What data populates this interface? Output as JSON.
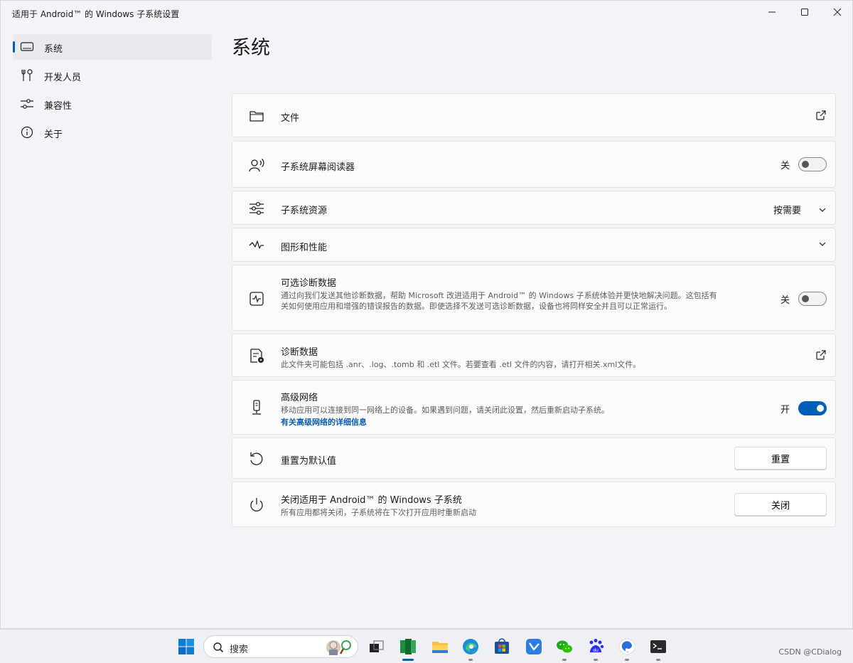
{
  "window": {
    "title": "适用于 Android™ 的 Windows 子系统设置"
  },
  "sidebar": {
    "items": [
      {
        "label": "系统",
        "icon": "monitor-icon",
        "active": true
      },
      {
        "label": "开发人员",
        "icon": "tools-icon"
      },
      {
        "label": "兼容性",
        "icon": "sliders-icon"
      },
      {
        "label": "关于",
        "icon": "info-icon"
      }
    ]
  },
  "page": {
    "title": "系统"
  },
  "settings": {
    "files": {
      "label": "文件",
      "icon": "folder-icon",
      "action_icon": "external-link-icon"
    },
    "screen_reader": {
      "label": "子系统屏幕阅读器",
      "icon": "screen-reader-icon",
      "state": "关",
      "toggle": "off"
    },
    "resources": {
      "label": "子系统资源",
      "icon": "sliders-icon",
      "value": "按需要",
      "action_icon": "chevron-down-icon"
    },
    "graphics": {
      "label": "图形和性能",
      "icon": "performance-icon",
      "action_icon": "chevron-down-icon"
    },
    "optional_diag": {
      "label": "可选诊断数据",
      "icon": "activity-icon",
      "desc": "通过向我们发送其他诊断数据，帮助 Microsoft 改进适用于 Android™ 的 Windows 子系统体验并更快地解决问题。这包括有关如何使用应用和增强的错误报告的数据。即使选择不发送可选诊断数据，设备也将同样安全并且可以正常运行。",
      "state": "关",
      "toggle": "off"
    },
    "diag_data": {
      "label": "诊断数据",
      "icon": "diagnostic-file-icon",
      "desc": "此文件夹可能包括 .anr、.log、.tomb 和 .etl 文件。若要查看 .etl 文件的内容，请打开相关.xml文件。",
      "action_icon": "external-link-icon"
    },
    "advanced_net": {
      "label": "高级网络",
      "icon": "network-device-icon",
      "desc": "移动应用可以连接到同一网络上的设备。如果遇到问题，请关闭此设置，然后重新启动子系统。",
      "link": "有关高级网络的详细信息",
      "state": "开",
      "toggle": "on"
    },
    "reset": {
      "label": "重置为默认值",
      "icon": "reset-icon",
      "button": "重置"
    },
    "shutdown": {
      "label": "关闭适用于 Android™ 的 Windows 子系统",
      "icon": "power-icon",
      "desc": "所有应用都将关闭，子系统将在下次打开应用时重新启动",
      "button": "关闭"
    }
  },
  "taskbar": {
    "search_label": "搜索",
    "apps": [
      "windows-start-icon",
      "task-view-icon",
      "subsystem-app-icon",
      "file-explorer-icon",
      "edge-icon",
      "store-icon",
      "feishu-icon",
      "wechat-icon",
      "baidu-icon",
      "app-icon",
      "terminal-icon"
    ]
  },
  "watermark": "CSDN @CDialog",
  "colors": {
    "accent": "#005fb8",
    "link": "#0f5db0"
  }
}
